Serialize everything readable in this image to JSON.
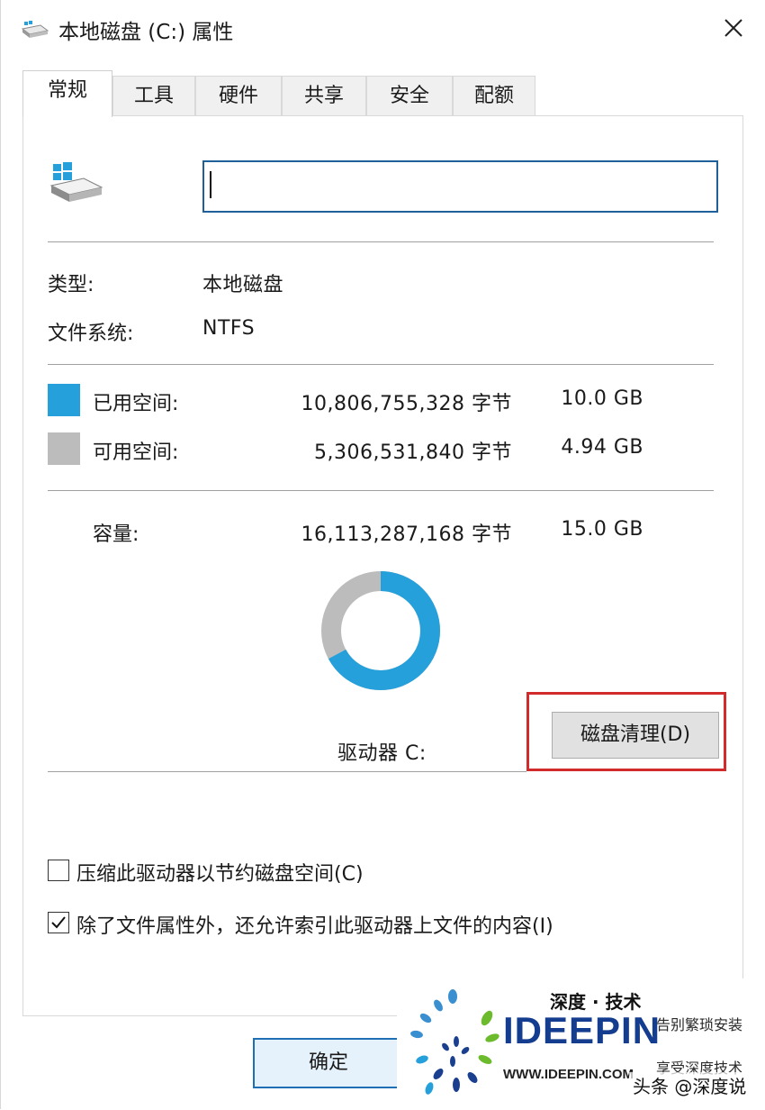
{
  "window": {
    "title": "本地磁盘 (C:) 属性"
  },
  "tabs": [
    {
      "label": "常规",
      "active": true
    },
    {
      "label": "工具"
    },
    {
      "label": "硬件"
    },
    {
      "label": "共享"
    },
    {
      "label": "安全"
    },
    {
      "label": "配额"
    }
  ],
  "general": {
    "drive_name_value": "",
    "type_label": "类型:",
    "type_value": "本地磁盘",
    "fs_label": "文件系统:",
    "fs_value": "NTFS",
    "used": {
      "label": "已用空间:",
      "bytes": "10,806,755,328 字节",
      "size": "10.0 GB",
      "color": "#26a0da"
    },
    "free": {
      "label": "可用空间:",
      "bytes": "5,306,531,840 字节",
      "size": "4.94 GB",
      "color": "#bcbcbc"
    },
    "capacity": {
      "label": "容量:",
      "bytes": "16,113,287,168 字节",
      "size": "15.0 GB"
    },
    "used_fraction": 0.6707,
    "drive_label": "驱动器 C:",
    "cleanup_button": "磁盘清理(D)",
    "compress_checkbox": {
      "label": "压缩此驱动器以节约磁盘空间(C)",
      "checked": false
    },
    "index_checkbox": {
      "label": "除了文件属性外，还允许索引此驱动器上文件的内容(I)",
      "checked": true
    }
  },
  "footer": {
    "ok_button": "确定"
  },
  "watermark": {
    "cn_title": "深度 · 技术",
    "brand": "IDEEPIN",
    "slogan1": "告别繁琐安装",
    "slogan2": "享受深度技术",
    "url": "WWW.IDEEPIN.COM",
    "credit": "头条 @深度说"
  },
  "colors": {
    "accent": "#26a0da",
    "highlight": "#d22b2b"
  }
}
